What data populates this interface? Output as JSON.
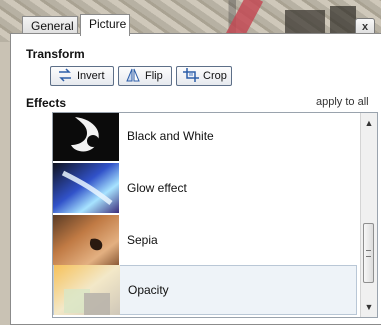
{
  "tabs": [
    {
      "label": "General",
      "active": false
    },
    {
      "label": "Picture",
      "active": true
    }
  ],
  "window": {
    "close_label": "x"
  },
  "transform": {
    "title": "Transform",
    "buttons": [
      {
        "label": "Invert",
        "icon": "invert-icon"
      },
      {
        "label": "Flip",
        "icon": "flip-icon"
      },
      {
        "label": "Crop",
        "icon": "crop-icon"
      }
    ]
  },
  "effects": {
    "title": "Effects",
    "apply_link": "apply to all",
    "items": [
      {
        "label": "Black and White",
        "thumb": "black-and-white-thumbnail",
        "selected": false
      },
      {
        "label": "Glow effect",
        "thumb": "glow-thumbnail",
        "selected": false
      },
      {
        "label": "Sepia",
        "thumb": "sepia-thumbnail",
        "selected": false
      },
      {
        "label": "Opacity",
        "thumb": "opacity-thumbnail",
        "selected": true
      }
    ]
  },
  "colors": {
    "selected_bg": "#eef3f8",
    "button_border": "#5d6f88"
  }
}
